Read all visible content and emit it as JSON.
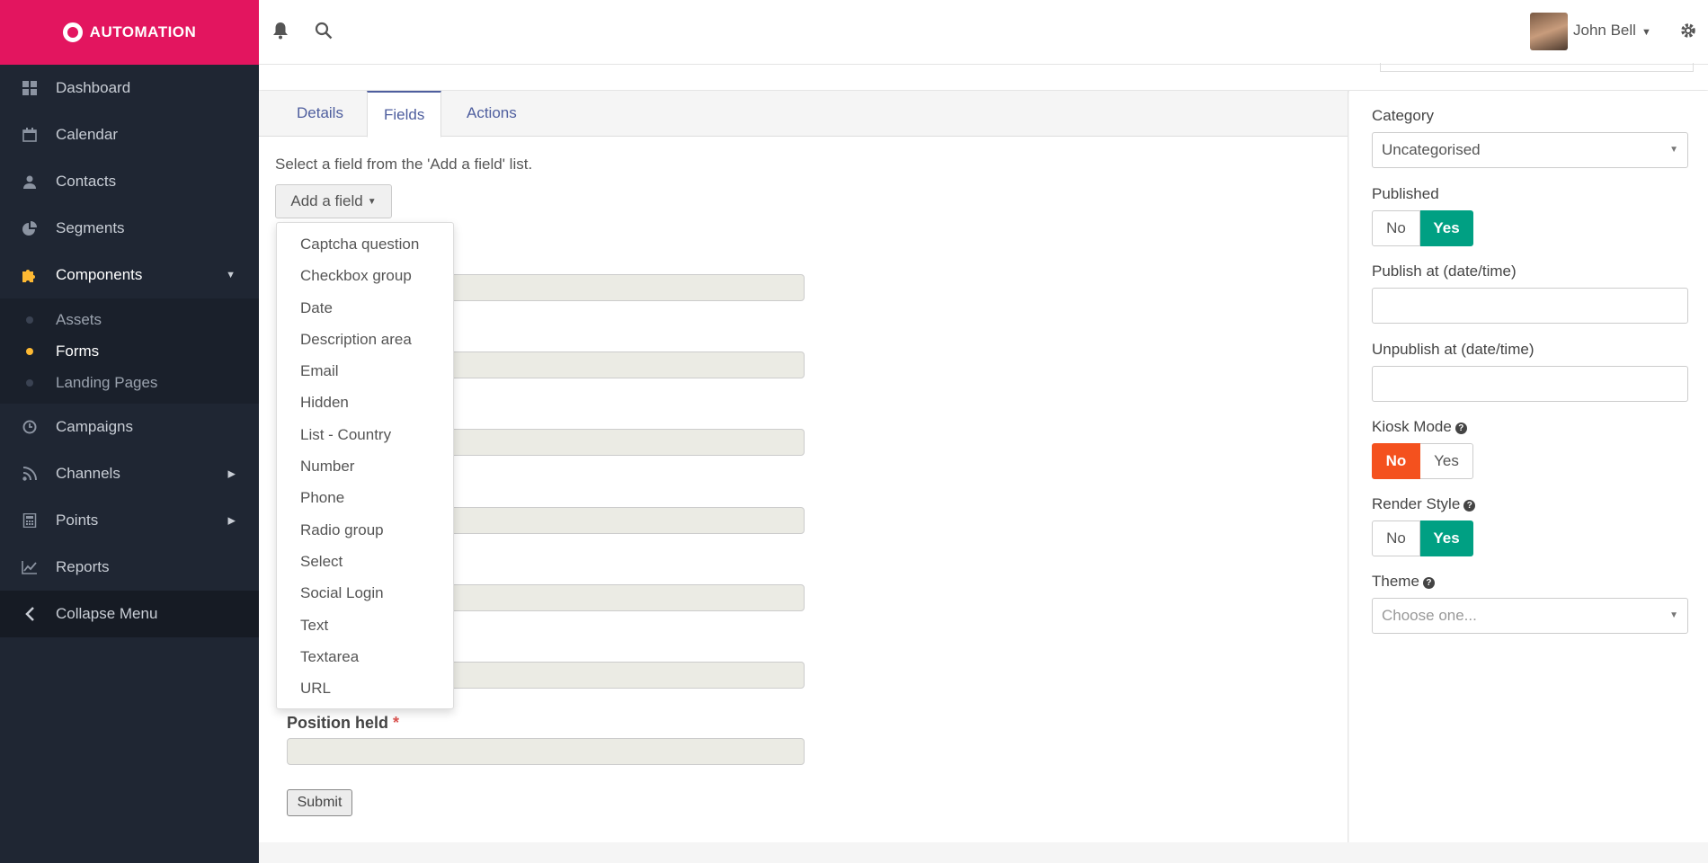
{
  "brand": {
    "name": "AUTOMATION"
  },
  "sidebar": {
    "items": [
      {
        "label": "Dashboard",
        "icon": "dashboard-icon"
      },
      {
        "label": "Calendar",
        "icon": "calendar-icon"
      },
      {
        "label": "Contacts",
        "icon": "user-icon"
      },
      {
        "label": "Segments",
        "icon": "pie-chart-icon"
      },
      {
        "label": "Components",
        "icon": "puzzle-icon"
      },
      {
        "label": "Campaigns",
        "icon": "clock-icon"
      },
      {
        "label": "Channels",
        "icon": "rss-icon"
      },
      {
        "label": "Points",
        "icon": "calculator-icon"
      },
      {
        "label": "Reports",
        "icon": "line-chart-icon"
      },
      {
        "label": "Collapse Menu",
        "icon": "chevron-left-icon"
      }
    ],
    "components_sub": [
      {
        "label": "Assets"
      },
      {
        "label": "Forms"
      },
      {
        "label": "Landing Pages"
      }
    ]
  },
  "header": {
    "user_name": "John Bell"
  },
  "tabs": [
    {
      "label": "Details"
    },
    {
      "label": "Fields"
    },
    {
      "label": "Actions"
    }
  ],
  "fields": {
    "hint": "Select a field from the 'Add a field' list.",
    "add_button": "Add a field",
    "dropdown_items": [
      "Captcha question",
      "Checkbox group",
      "Date",
      "Description area",
      "Email",
      "Hidden",
      "List - Country",
      "Number",
      "Phone",
      "Radio group",
      "Select",
      "Social Login",
      "Text",
      "Textarea",
      "URL"
    ],
    "position_label": "Position held",
    "required_mark": "*",
    "submit_label": "Submit"
  },
  "side": {
    "category_label": "Category",
    "category_value": "Uncategorised",
    "published_label": "Published",
    "publish_at_label": "Publish at (date/time)",
    "unpublish_at_label": "Unpublish at (date/time)",
    "kiosk_label": "Kiosk Mode",
    "render_label": "Render Style",
    "theme_label": "Theme",
    "theme_placeholder": "Choose one...",
    "no": "No",
    "yes": "Yes",
    "help_glyph": "?"
  },
  "colors": {
    "brand": "#e3155f",
    "sidebar": "#1f2633",
    "accent_green": "#00a083",
    "accent_red": "#f4511e",
    "active_dot": "#fdb933",
    "tab_text": "#4e5e9e"
  }
}
